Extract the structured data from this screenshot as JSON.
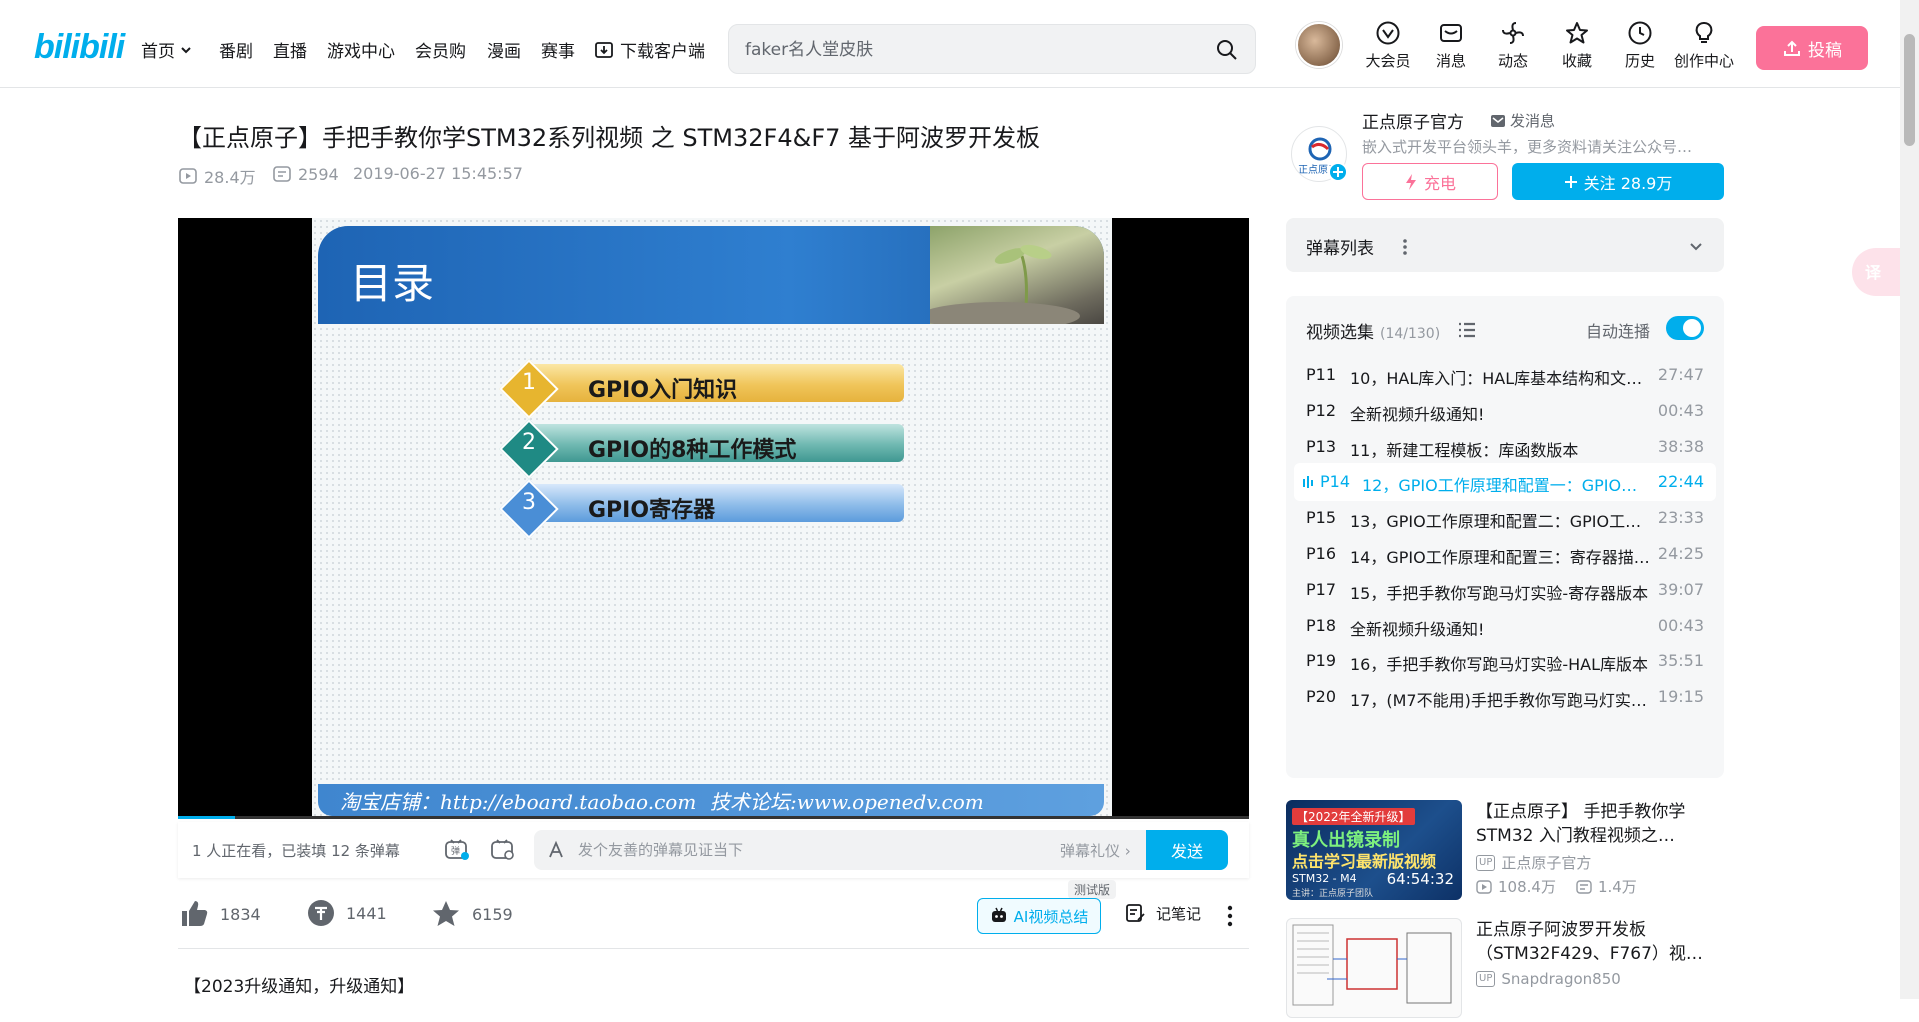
{
  "header": {
    "logo": "bilibili",
    "nav": [
      "首页",
      "番剧",
      "直播",
      "游戏中心",
      "会员购",
      "漫画",
      "赛事",
      "下载客户端"
    ],
    "search_placeholder": "faker名人堂皮肤",
    "icons": [
      {
        "name": "vip-icon",
        "label": "大会员"
      },
      {
        "name": "message-icon",
        "label": "消息"
      },
      {
        "name": "dynamic-icon",
        "label": "动态"
      },
      {
        "name": "favorite-icon",
        "label": "收藏"
      },
      {
        "name": "history-icon",
        "label": "历史"
      },
      {
        "name": "creator-icon",
        "label": "创作中心"
      }
    ],
    "upload_label": "投稿"
  },
  "video": {
    "title": "【正点原子】手把手教你学STM32系列视频 之 STM32F4&F7 基于阿波罗开发板",
    "views": "28.4万",
    "danmaku_count": "2594",
    "date": "2019-06-27 15:45:57",
    "progress": 0.053
  },
  "slide": {
    "title": "目录",
    "items": [
      {
        "num": "1",
        "text": "GPIO入门知识"
      },
      {
        "num": "2",
        "text": "GPIO的8种工作模式"
      },
      {
        "num": "3",
        "text": "GPIO寄存器"
      }
    ],
    "footer_left": "淘宝店铺：http://eboard.taobao.com",
    "footer_right": "技术论坛:www.openedv.com"
  },
  "danmaku_bar": {
    "info": "1 人正在看，已装填 12 条弹幕",
    "placeholder": "发个友善的弹幕见证当下",
    "etiquette": "弹幕礼仪 ›",
    "send": "发送"
  },
  "actions": {
    "likes": "1834",
    "coins": "1441",
    "favorites": "6159",
    "ai_summary": "AI视频总结",
    "test_badge": "测试版",
    "notes": "记笔记"
  },
  "description": "【2023升级通知，升级通知】",
  "uploader": {
    "name": "正点原子官方",
    "message": "发消息",
    "desc": "嵌入式开发平台领头羊，更多资料请关注公众号…",
    "charge": "充电",
    "follow": "关注 28.9万",
    "avatar_text": "正点原子"
  },
  "danmaku_list": {
    "label": "弹幕列表"
  },
  "playlist": {
    "title": "视频选集",
    "count": "(14/130)",
    "autoplay": "自动连播",
    "episodes": [
      {
        "p": "P11",
        "name": "10，HAL库入门：HAL库基本结构和文件…",
        "dur": "27:47",
        "active": false
      },
      {
        "p": "P12",
        "name": "全新视频升级通知!",
        "dur": "00:43",
        "active": false
      },
      {
        "p": "P13",
        "name": "11，新建工程模板：库函数版本",
        "dur": "38:38",
        "active": false
      },
      {
        "p": "P14",
        "name": "12，GPIO工作原理和配置一：GPIO基…",
        "dur": "22:44",
        "active": true
      },
      {
        "p": "P15",
        "name": "13，GPIO工作原理和配置二：GPIO工作…",
        "dur": "23:33",
        "active": false
      },
      {
        "p": "P16",
        "name": "14，GPIO工作原理和配置三：寄存器描…",
        "dur": "24:25",
        "active": false
      },
      {
        "p": "P17",
        "name": "15，手把手教你写跑马灯实验-寄存器版本",
        "dur": "39:07",
        "active": false
      },
      {
        "p": "P18",
        "name": "全新视频升级通知!",
        "dur": "00:43",
        "active": false
      },
      {
        "p": "P19",
        "name": "16，手把手教你写跑马灯实验-HAL库版本",
        "dur": "35:51",
        "active": false
      },
      {
        "p": "P20",
        "name": "17，(M7不能用)手把手教你写跑马灯实验…",
        "dur": "19:15",
        "active": false
      }
    ]
  },
  "recommendations": [
    {
      "title": "【正点原子】 手把手教你学STM32 入门教程视频之…",
      "up": "正点原子官方",
      "views": "108.4万",
      "danmaku": "1.4万",
      "thumb_tag": "【2022年全新升级】",
      "thumb_line1": "真人出镜录制",
      "thumb_line2": "点击学习最新版视频",
      "thumb_model": "STM32 - M4",
      "thumb_dur": "64:54:32",
      "thumb_author": "主讲：正点原子团队"
    },
    {
      "title": "正点原子阿波罗开发板（STM32F429、F767）视…",
      "up": "Snapdragon850"
    }
  ],
  "colors": {
    "brand": "#00aeec",
    "pink": "#fb7299"
  }
}
